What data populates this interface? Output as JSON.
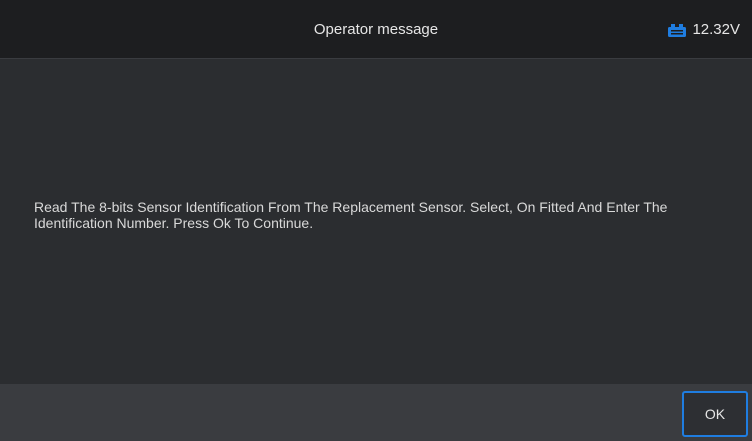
{
  "header": {
    "title": "Operator message",
    "voltage": "12.32V",
    "battery_icon": "car-battery-icon",
    "accent_color": "#1f7de0"
  },
  "content": {
    "message": "Read The 8-bits Sensor Identification From The Replacement Sensor. Select, On Fitted And Enter The Identification Number. Press Ok To Continue."
  },
  "footer": {
    "ok_label": "OK"
  }
}
